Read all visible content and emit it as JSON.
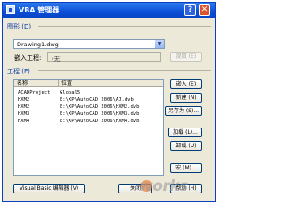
{
  "window": {
    "title": "VBA 管理器"
  },
  "drawing": {
    "group_label": "图形 (D)",
    "selected_drawing": "Drawing1.dwg",
    "embedded_label": "嵌入工程:",
    "embedded_value": "(无)",
    "embed_button": "嵌入 (E)"
  },
  "project": {
    "group_label": "工程 (P)",
    "columns": [
      "名称",
      "位置"
    ],
    "rows": [
      {
        "name": "ACADProject",
        "location": "Global5"
      },
      {
        "name": "HXM2",
        "location": "E:\\XP\\AutoCAD 2006\\AJ.dvb"
      },
      {
        "name": "HXM2",
        "location": "E:\\XP\\AutoCAD 2006\\HXM2.dvb"
      },
      {
        "name": "HXM3",
        "location": "E:\\XP\\AutoCAD 2006\\HXM3.dvb"
      },
      {
        "name": "HXM4",
        "location": "E:\\XP\\AutoCAD 2006\\HXM4.dvb"
      }
    ],
    "buttons": {
      "extract": "提取 (E)",
      "embed": "嵌入 (E)",
      "new": "新建 (N)",
      "save_as": "另存为 (S)...",
      "load": "加载 (L)...",
      "unload": "卸载 (U)",
      "macros": "宏 (M)..."
    }
  },
  "footer": {
    "vbe_button": "Visual Basic 编辑器 (V)",
    "close_button": "关闭",
    "help_button": "帮助 (H)"
  },
  "watermark": {
    "text": "works"
  }
}
